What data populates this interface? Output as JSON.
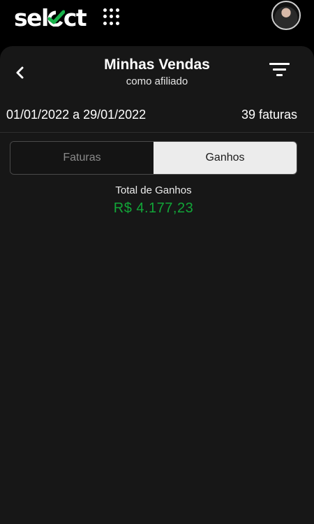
{
  "header": {
    "logo_text": "select",
    "logo_part1": "sel",
    "logo_part2": "ct",
    "accent_color": "#18b24a"
  },
  "page": {
    "title": "Minhas Vendas",
    "subtitle": "como afiliado"
  },
  "filters": {
    "date_range": "01/01/2022 a 29/01/2022",
    "invoice_count": "39 faturas"
  },
  "tabs": [
    {
      "label": "Faturas",
      "active": false
    },
    {
      "label": "Ganhos",
      "active": true
    }
  ],
  "summary": {
    "label": "Total de Ganhos",
    "value": "R$  4.177,23",
    "value_color": "#12a538"
  },
  "icons": {
    "back": "chevron-left-icon",
    "apps": "apps-grid-icon",
    "filter": "filter-icon"
  }
}
